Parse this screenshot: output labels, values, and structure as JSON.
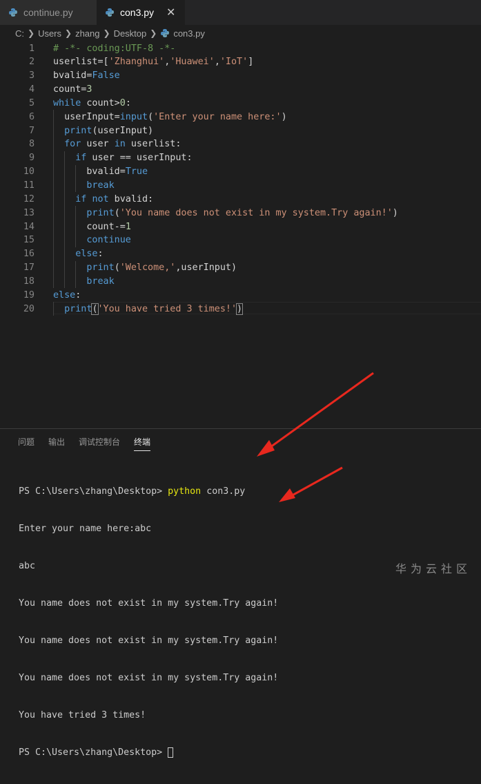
{
  "tabs": [
    {
      "label": "continue.py",
      "active": false
    },
    {
      "label": "con3.py",
      "active": true,
      "close": "✕"
    }
  ],
  "breadcrumb": [
    "C:",
    "Users",
    "zhang",
    "Desktop",
    "con3.py"
  ],
  "editor": {
    "line_numbers": [
      "1",
      "2",
      "3",
      "4",
      "5",
      "6",
      "7",
      "8",
      "9",
      "10",
      "11",
      "12",
      "13",
      "14",
      "15",
      "16",
      "17",
      "18",
      "19",
      "20"
    ],
    "lines": [
      "# -*- coding:UTF-8 -*-",
      "userlist=['Zhanghui','Huawei','IoT']",
      "bvalid=False",
      "count=3",
      "while count>0:",
      "  userInput=input('Enter your name here:')",
      "  print(userInput)",
      "  for user in userlist:",
      "    if user == userInput:",
      "      bvalid=True",
      "      break",
      "    if not bvalid:",
      "      print('You name does not exist in my system.Try again!')",
      "      count-=1",
      "      continue",
      "    else:",
      "      print('Welcome,',userInput)",
      "      break",
      "else:",
      "  print('You have tried 3 times!')"
    ]
  },
  "panel": {
    "tabs": [
      "问题",
      "输出",
      "调试控制台",
      "终端"
    ],
    "active_tab": "终端",
    "terminal": {
      "prompt": "PS C:\\Users\\zhang\\Desktop> ",
      "command": "python",
      "command_arg": " con3.py",
      "output": [
        "Enter your name here:abc",
        "abc",
        "You name does not exist in my system.Try again!",
        "You name does not exist in my system.Try again!",
        "You name does not exist in my system.Try again!",
        "You have tried 3 times!"
      ],
      "final_prompt": "PS C:\\Users\\zhang\\Desktop> "
    }
  },
  "watermark": "华为云社区",
  "colors": {
    "background": "#1e1e1e",
    "keyword": "#569cd6",
    "control": "#c586c0",
    "string": "#ce9178",
    "comment": "#6a9955",
    "function": "#dcdcaa",
    "number": "#b5cea8",
    "terminal_command": "#e5e510",
    "arrow": "#e8281e"
  }
}
